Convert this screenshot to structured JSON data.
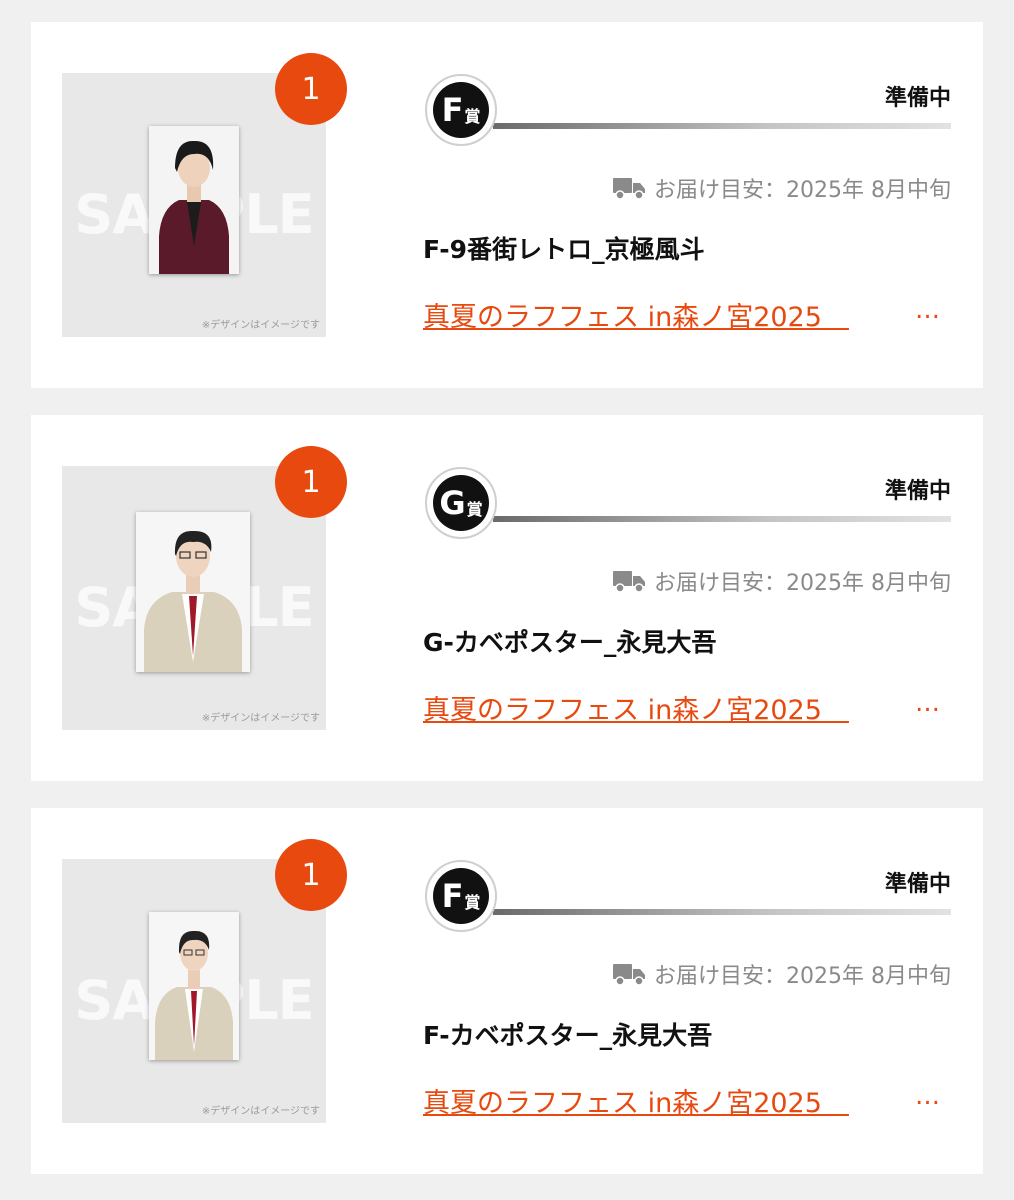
{
  "items": [
    {
      "quantity": "1",
      "prize_letter": "F",
      "prize_suffix": "賞",
      "status": "準備中",
      "delivery": "お届け目安：2025年 8月中旬",
      "title": "F-9番街レトロ_京極風斗",
      "event": "真夏のラフフェス in森ノ宮2025　",
      "ellipsis": "…",
      "watermark": "SAMPLE",
      "disclaimer": "※デザインはイメージです",
      "photo": "portrait-dark-suit"
    },
    {
      "quantity": "1",
      "prize_letter": "G",
      "prize_suffix": "賞",
      "status": "準備中",
      "delivery": "お届け目安：2025年 8月中旬",
      "title": "G-カベポスター_永見大吾",
      "event": "真夏のラフフェス in森ノ宮2025　",
      "ellipsis": "…",
      "watermark": "SAMPLE",
      "disclaimer": "※デザインはイメージです",
      "photo": "portrait-beige-suit"
    },
    {
      "quantity": "1",
      "prize_letter": "F",
      "prize_suffix": "賞",
      "status": "準備中",
      "delivery": "お届け目安：2025年 8月中旬",
      "title": "F-カベポスター_永見大吾",
      "event": "真夏のラフフェス in森ノ宮2025　",
      "ellipsis": "…",
      "watermark": "SAMPLE",
      "disclaimer": "※デザインはイメージです",
      "photo": "portrait-beige-suit"
    }
  ],
  "colors": {
    "accent": "#e8490f",
    "background": "#f0f0f0",
    "card": "#ffffff",
    "muted": "#8a8a8a"
  }
}
